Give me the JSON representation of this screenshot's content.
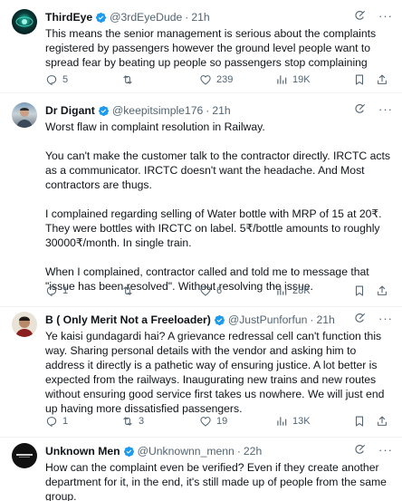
{
  "tweets": [
    {
      "name": "ThirdEye",
      "handle": "@3rdEyeDude",
      "time": "21h",
      "text": "This means the senior management is serious about the complaints registered by passengers however the ground level people want to spread fear by beating up people so passengers stop complaining",
      "replies": "5",
      "retweets": "",
      "likes": "239",
      "views": "19K"
    },
    {
      "name": "Dr Digant",
      "handle": "@keepitsimple176",
      "time": "21h",
      "text": "Worst flaw in complaint resolution in Railway.\n\nYou can't make the customer talk to the contractor directly. IRCTC acts as a communicator. IRCTC doesn't want the headache. And Most contractors are thugs.\n\nI complained regarding selling of Water bottle with MRP of 15 at 20₹. They were bottles with IRCTC on label. 5₹/bottle amounts to roughly 30000₹/month. In single train.\n\nWhen I complained, contractor called and told me to message that \"issue has been resolved\".  Without resolving the issue.",
      "replies": "1",
      "retweets": "",
      "likes": "6",
      "views": "28K"
    },
    {
      "name": "B ( Only Merit Not a Freeloader)",
      "handle": "@JustPunforfun",
      "time": "21h",
      "text": "Ye kaisi gundagardi hai? A grievance redressal cell can't function this way. Sharing personal details with the vendor and asking him to address it directly  is a pathetic way of ensuring justice. A lot better is expected from the railways. Inaugurating new trains and new routes without ensuring good service first takes us nowhere. We will just end up having more dissatisfied passengers.",
      "replies": "1",
      "retweets": "3",
      "likes": "19",
      "views": "13K"
    },
    {
      "name": "Unknown Men",
      "handle": "@Unknownn_menn",
      "time": "22h",
      "text": "How can the complaint even be verified? Even if they create another department for it, in the end, it's still made up of people from the same group."
    }
  ],
  "colors": {
    "verified": "#1d9bf0",
    "secondary_text": "#536471",
    "primary_text": "#0f1419",
    "divider": "#eff3f4"
  },
  "icons": [
    "verified-badge-icon",
    "grok-icon",
    "more-icon",
    "reply-icon",
    "retweet-icon",
    "like-icon",
    "views-icon",
    "bookmark-icon",
    "share-icon"
  ]
}
